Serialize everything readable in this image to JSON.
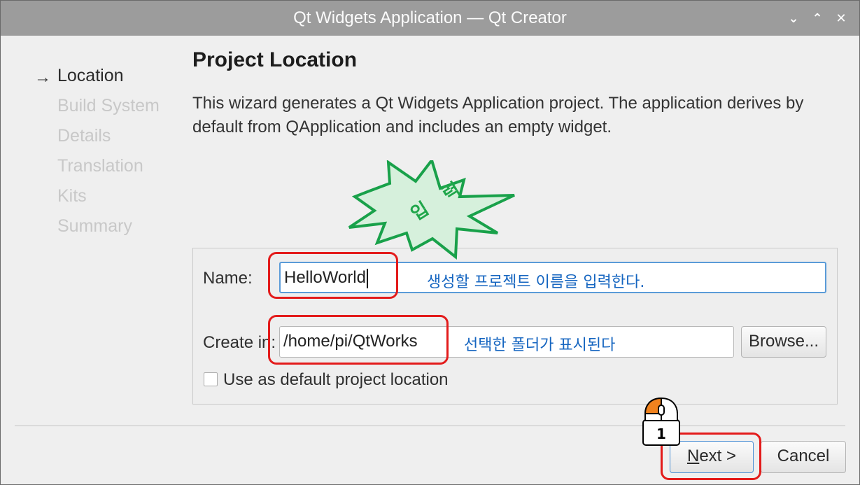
{
  "window": {
    "title": "Qt Widgets Application — Qt Creator",
    "controls": {
      "minimize": "⌄",
      "maximize": "⌃",
      "close": "✕"
    }
  },
  "wizard": {
    "steps": [
      {
        "label": "Location",
        "current": true
      },
      {
        "label": "Build System",
        "current": false
      },
      {
        "label": "Details",
        "current": false
      },
      {
        "label": "Translation",
        "current": false
      },
      {
        "label": "Kits",
        "current": false
      },
      {
        "label": "Summary",
        "current": false
      }
    ],
    "current_step_marker": "→",
    "page_title": "Project Location",
    "description": "This wizard generates a Qt Widgets Application project. The application derives by default from QApplication and includes an empty widget."
  },
  "form": {
    "name_label": "Name:",
    "name_value": "HelloWorld",
    "create_in_label": "Create in:",
    "create_in_value": "/home/pi/QtWorks",
    "browse_label": "Browse...",
    "default_location_label": "Use as default project location",
    "default_location_checked": false
  },
  "buttons": {
    "next_label": "Next >",
    "next_mnemonic": "N",
    "next_rest": "ext >",
    "cancel_label": "Cancel"
  },
  "annotations": {
    "starburst_text": "입 력",
    "name_hint": "생성할 프로젝트 이름을 입력한다.",
    "folder_hint": "선택한 폴더가 표시된다",
    "mouse_step": "1",
    "colors": {
      "highlight": "#e31b1b",
      "hint_text": "#1565c0",
      "starburst_fill": "#d6f0dc",
      "starburst_stroke": "#19a14a",
      "mouse_button": "#f0821e"
    }
  }
}
